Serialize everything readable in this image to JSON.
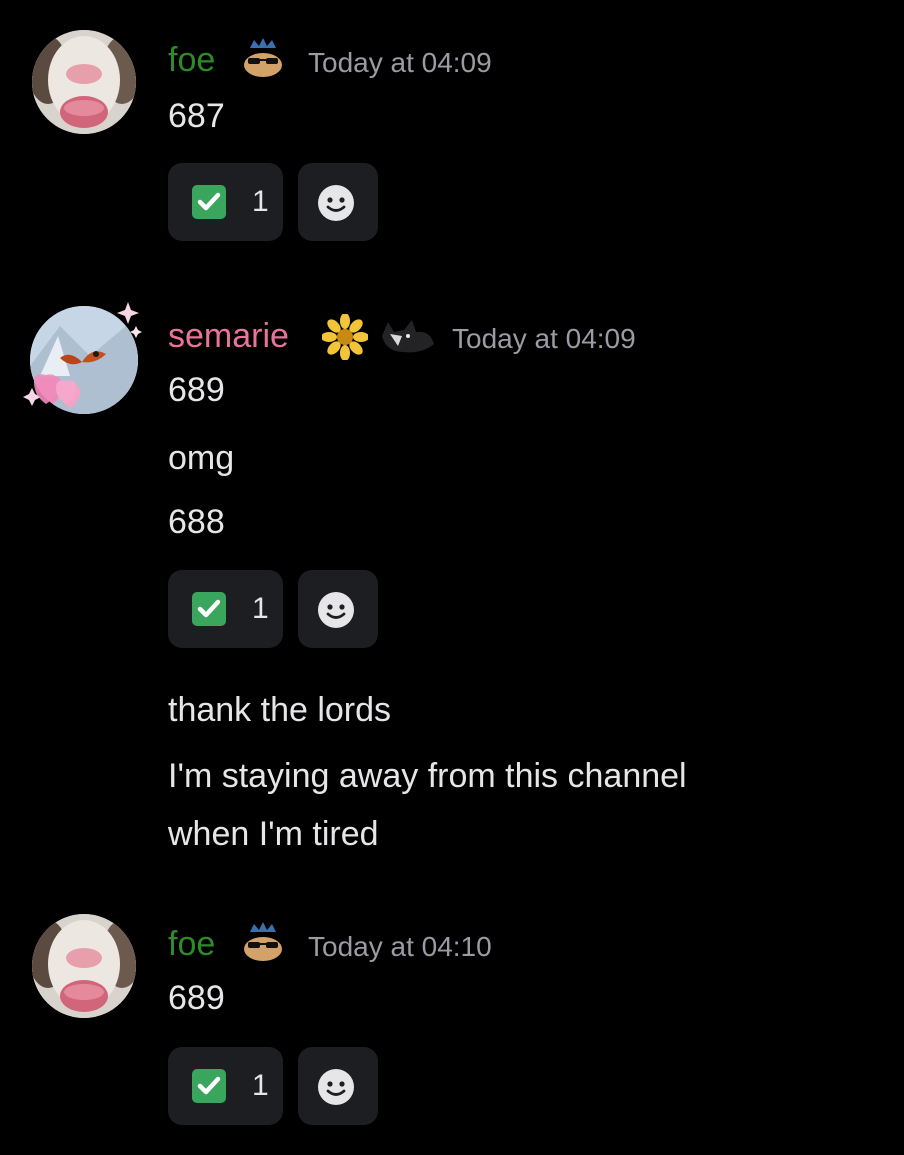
{
  "colors": {
    "background": "#000000",
    "foe_name": "#2f8a2a",
    "semarie_name": "#e8749a",
    "timestamp": "#9a9ba3",
    "message_text": "#e6e6e8",
    "reaction_bg": "#1d1e22",
    "check_green": "#3aa55d"
  },
  "messages": [
    {
      "author": "foe",
      "timestamp": "Today at 04:09",
      "avatar": "guinea-pig-avatar",
      "badges": [
        "sunglasses-crown-cat-badge"
      ],
      "lines": [
        "687"
      ],
      "reaction": {
        "emoji": "white-check-mark-icon",
        "count": "1",
        "add_icon": "add-reaction-smile-icon"
      }
    },
    {
      "author": "semarie",
      "timestamp": "Today at 04:09",
      "avatar": "butterfly-hearts-avatar",
      "badges": [
        "sunflower-badge",
        "black-cat-badge"
      ],
      "lines": [
        "689",
        "omg",
        "688"
      ],
      "reaction": {
        "emoji": "white-check-mark-icon",
        "count": "1",
        "add_icon": "add-reaction-smile-icon"
      },
      "followup_lines": [
        "thank the lords",
        "I'm staying away from this channel",
        "when I'm tired"
      ]
    },
    {
      "author": "foe",
      "timestamp": "Today at 04:10",
      "avatar": "guinea-pig-avatar",
      "badges": [
        "sunglasses-crown-cat-badge"
      ],
      "lines": [
        "689"
      ],
      "reaction": {
        "emoji": "white-check-mark-icon",
        "count": "1",
        "add_icon": "add-reaction-smile-icon"
      }
    }
  ]
}
